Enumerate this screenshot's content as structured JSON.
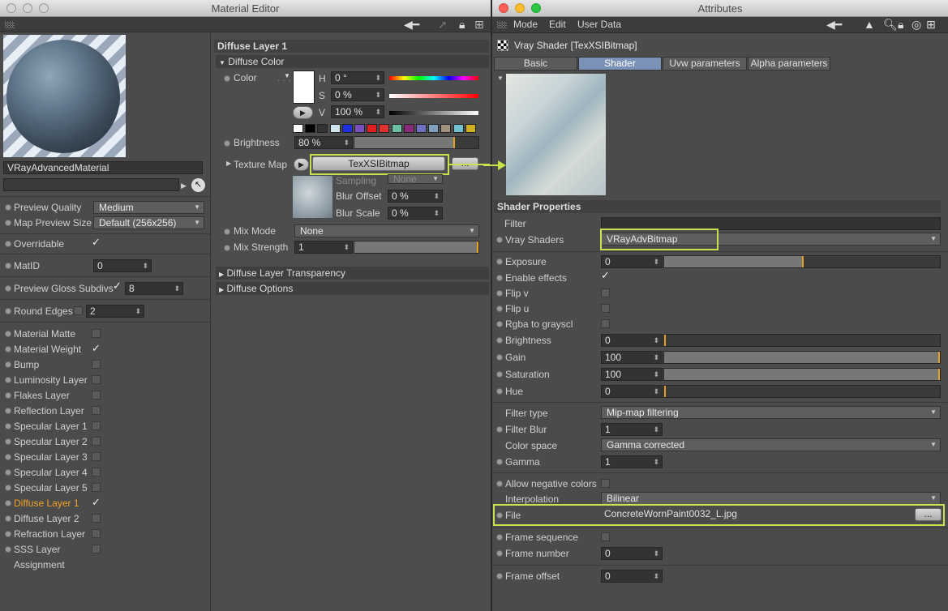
{
  "material_editor": {
    "title": "Material Editor",
    "material_name": "VRayAdvancedMaterial",
    "left_fields": [
      {
        "label": "Preview Quality",
        "value": "Medium"
      },
      {
        "label": "Map Preview Size",
        "value": "Default (256x256)"
      },
      {
        "label": "Overridable"
      },
      {
        "label": "MatID",
        "value": "0"
      },
      {
        "label": "Preview Gloss Subdivs",
        "value": "8"
      },
      {
        "label": "Round Edges",
        "value": "2"
      }
    ],
    "channels": [
      {
        "label": "Material Matte",
        "checked": false
      },
      {
        "label": "Material Weight",
        "checked": true
      },
      {
        "label": "Bump",
        "checked": false
      },
      {
        "label": "Luminosity Layer",
        "checked": false
      },
      {
        "label": "Flakes Layer",
        "checked": false
      },
      {
        "label": "Reflection Layer",
        "checked": false
      },
      {
        "label": "Specular Layer 1",
        "checked": false
      },
      {
        "label": "Specular Layer 2",
        "checked": false
      },
      {
        "label": "Specular Layer 3",
        "checked": false
      },
      {
        "label": "Specular Layer 4",
        "checked": false
      },
      {
        "label": "Specular Layer 5",
        "checked": false
      },
      {
        "label": "Diffuse Layer 1",
        "checked": true,
        "selected": true
      },
      {
        "label": "Diffuse Layer 2",
        "checked": false
      },
      {
        "label": "Refraction Layer",
        "checked": false
      },
      {
        "label": "SSS Layer",
        "checked": false
      },
      {
        "label": "Assignment"
      }
    ],
    "panel_title": "Diffuse Layer 1",
    "section_diffuse_color": "Diffuse Color",
    "color_label": "Color",
    "h_label": "H",
    "h_value": "0 °",
    "s_label": "S",
    "s_value": "0 %",
    "v_label": "V",
    "v_value": "100 %",
    "swatches": [
      "#ffffff",
      "#000000",
      "#333333",
      "#cfe6ee",
      "#1f2fe0",
      "#7a4fc0",
      "#e02020",
      "#e03030",
      "#6ac0a0",
      "#8a2a7a",
      "#7070c0",
      "#80a0c0",
      "#a09080",
      "#70c0d0",
      "#d0b020"
    ],
    "brightness_label": "Brightness",
    "brightness_value": "80 %",
    "brightness_level": 0.8,
    "texture_map_label": "Texture Map",
    "texture_map_value": "TexXSIBitmap",
    "more_button": "...",
    "sampling_label": "Sampling",
    "sampling_value": "None",
    "blur_offset_label": "Blur Offset",
    "blur_offset_value": "0 %",
    "blur_scale_label": "Blur Scale",
    "blur_scale_value": "0 %",
    "mix_mode_label": "Mix Mode",
    "mix_mode_value": "None",
    "mix_strength_label": "Mix Strength",
    "mix_strength_value": "1",
    "section_transparency": "Diffuse Layer Transparency",
    "section_options": "Diffuse Options"
  },
  "attributes": {
    "title": "Attributes",
    "menu": [
      "Mode",
      "Edit",
      "User Data"
    ],
    "object_title": "Vray Shader [TexXSIBitmap]",
    "tabs": [
      {
        "label": "Basic",
        "active": false
      },
      {
        "label": "Shader",
        "active": true
      },
      {
        "label": "Uvw parameters",
        "active": false
      },
      {
        "label": "Alpha parameters",
        "active": false
      }
    ],
    "section_title": "Shader Properties",
    "filter_label": "Filter",
    "vray_shaders_label": "Vray Shaders",
    "vray_shaders_value": "VRayAdvBitmap",
    "exposure_label": "Exposure",
    "exposure_value": "0",
    "exposure_level": 0.5,
    "enable_effects_label": "Enable effects",
    "flip_v_label": "Flip v",
    "flip_u_label": "Flip u",
    "rgba_label": "Rgba to grayscl",
    "brightness_label": "Brightness",
    "brightness_value": "0",
    "gain_label": "Gain",
    "gain_value": "100",
    "saturation_label": "Saturation",
    "saturation_value": "100",
    "hue_label": "Hue",
    "hue_value": "0",
    "filter_type_label": "Filter type",
    "filter_type_value": "Mip-map filtering",
    "filter_blur_label": "Filter Blur",
    "filter_blur_value": "1",
    "color_space_label": "Color space",
    "color_space_value": "Gamma corrected",
    "gamma_label": "Gamma",
    "gamma_value": "1",
    "allow_negative_label": "Allow negative colors",
    "interpolation_label": "Interpolation",
    "interpolation_value": "Bilinear",
    "file_label": "File",
    "file_value": "ConcreteWornPaint0032_L.jpg",
    "file_button": "...",
    "frame_sequence_label": "Frame sequence",
    "frame_number_label": "Frame number",
    "frame_number_value": "0",
    "frame_offset_label": "Frame offset",
    "frame_offset_value": "0"
  },
  "colors": {
    "highlight": "#c7e34b",
    "selected_text": "#f2a229",
    "active_tab": "#7b92b8"
  }
}
